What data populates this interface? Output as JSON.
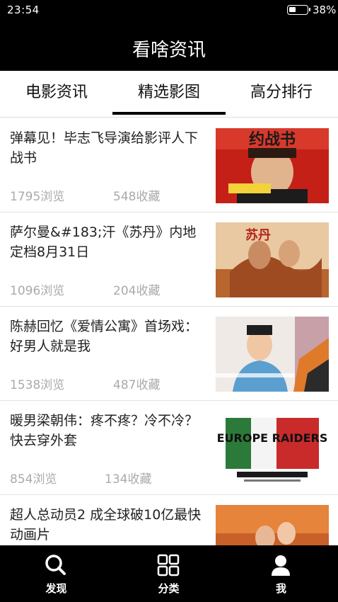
{
  "status_bar": {
    "time": "23:54",
    "battery": "38%",
    "battery_level": 0.38
  },
  "header": {
    "title": "看啥资讯"
  },
  "tabs": [
    {
      "label": "电影资讯"
    },
    {
      "label": "精选影图",
      "selected": true
    },
    {
      "label": "高分排行"
    }
  ],
  "articles": [
    {
      "title": "弹幕见！毕志飞导演给影评人下战书",
      "views": "1795浏览",
      "favorites": "548收藏",
      "thumb_icon": "poster-thumbnail",
      "thumb_text": "约战书"
    },
    {
      "title": "萨尔曼&#183;汗《苏丹》内地定档8月31日",
      "views": "1096浏览",
      "favorites": "204收藏",
      "thumb_icon": "poster-thumbnail",
      "thumb_text": "苏丹"
    },
    {
      "title": "陈赫回忆《爱情公寓》首场戏：好男人就是我",
      "views": "1538浏览",
      "favorites": "487收藏",
      "thumb_icon": "photo-thumbnail",
      "thumb_text": ""
    },
    {
      "title": "暖男梁朝伟：疼不疼？冷不冷？快去穿外套",
      "views": "854浏览",
      "favorites": "134收藏",
      "thumb_icon": "poster-thumbnail",
      "thumb_text": "EUROPE RAIDERS"
    },
    {
      "title": "超人总动员2  成全球破10亿最快动画片",
      "views": "",
      "favorites": "",
      "thumb_icon": "photo-thumbnail",
      "thumb_text": ""
    }
  ],
  "bottom_nav": [
    {
      "label": "发现",
      "icon": "search-icon"
    },
    {
      "label": "分类",
      "icon": "grid-icon"
    },
    {
      "label": "我",
      "icon": "person-icon"
    }
  ],
  "colors": {
    "bar_background": "#000000",
    "meta_text": "#aaaaaa",
    "divider": "#e2e2e2"
  }
}
